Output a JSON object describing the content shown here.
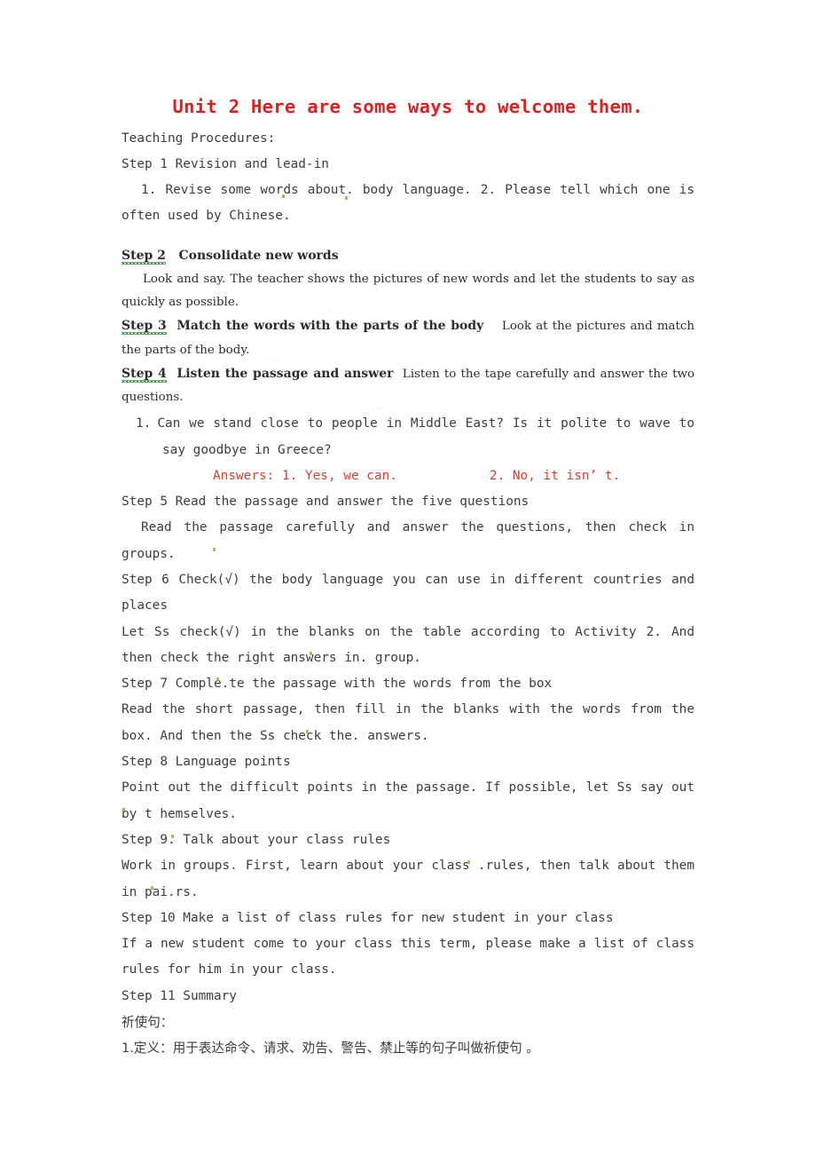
{
  "document": {
    "title": "Unit 2 Here are some ways to welcome them.",
    "title_color": "#e02020",
    "background_color": "#ffffff",
    "answers_color": "#e8392c",
    "spellcheck_underline_color": "#3a8f3a"
  },
  "body": {
    "teaching_procedures_label": "Teaching Procedures:",
    "step1_heading": "Step 1  Revision and lead-in",
    "step1_items": "1. Revise some words about. body language.    2. Please tell which one is often used by Chinese.",
    "step2_heading_prefix": "Step 2",
    "step2_heading_rest": "Consolidate new words",
    "step2_text": "Look and say. The teacher shows the pictures of new words and let the students to say as quickly as possible.",
    "step3_heading_prefix": "Step 3",
    "step3_heading_rest": "Match the words with the parts of the body",
    "step3_text": "Look at the pictures and match the parts of the body.",
    "step4_heading_prefix": "Step 4",
    "step4_heading_rest": "Listen the passage and answer",
    "step4_text": "Listen to the tape carefully and answer the two questions.",
    "question_number": "1.",
    "question_text": "Can we stand close to people in Middle East?   Is it polite to wave to say goodbye in Greece?",
    "answers_line": "Answers: 1. Yes, we can.            2. No, it isn’ t.",
    "step5_heading": "Step 5  Read the passage and answer the five questions",
    "step5_text": "Read the passage carefully and answer the questions, then check in groups.",
    "step6_heading": "Step 6  Check(√) the body language you can use in different countries and places",
    "step6_text": "Let Ss check(√) in the blanks on the table according to Activity 2. And then check the right answers in. group.",
    "step7_heading": "Step 7  Comple.te the passage with the words from the box",
    "step7_text": "Read the short passage, then fill in the blanks with the words from the box. And then the Ss check the. answers.",
    "step8_heading": "Step 8  Language points",
    "step8_text": "Point out the difficult points in the passage. If possible, let Ss say out by t hemselves.",
    "step9_heading": "Step 9.  Talk about your class rules",
    "step9_text": "Work in groups. First, learn about your class .rules, then talk about them in pai.rs.",
    "step10_heading": "Step 10  Make a list of class rules for new student in your class",
    "step10_text": "If a new student come to your class this term, please make a list of class rules for him in your class.",
    "step11_heading": "Step 11  Summary",
    "chinese_heading": "祈使句：",
    "chinese_definition": "1.定义：用于表达命令、请求、劝告、警告、禁止等的句子叫做祈使句 。"
  }
}
